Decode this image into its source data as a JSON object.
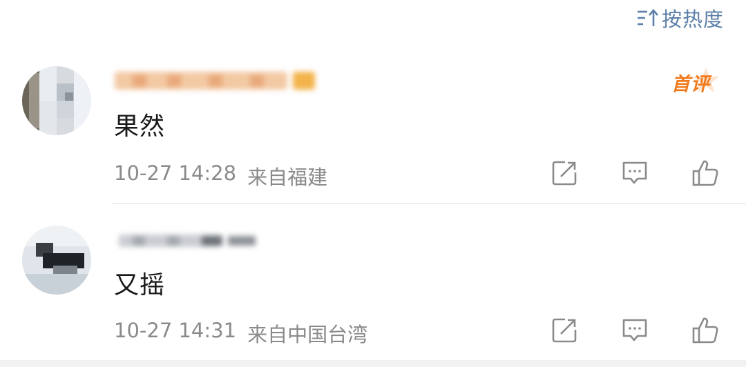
{
  "sort": {
    "label": "按热度",
    "icon": "sort-icon"
  },
  "comments": [
    {
      "text": "果然",
      "timestamp": "10-27 14:28",
      "location": "来自福建",
      "badge": "首评",
      "actions": [
        "share-icon",
        "comment-icon",
        "like-icon"
      ]
    },
    {
      "text": "又摇",
      "timestamp": "10-27 14:31",
      "location": "来自中国台湾",
      "actions": [
        "share-icon",
        "comment-icon",
        "like-icon"
      ]
    }
  ],
  "colors": {
    "accent": "#5b7fa8",
    "badge": "#f07a1c",
    "meta": "#8a8a8a",
    "text": "#1a1a1a"
  }
}
